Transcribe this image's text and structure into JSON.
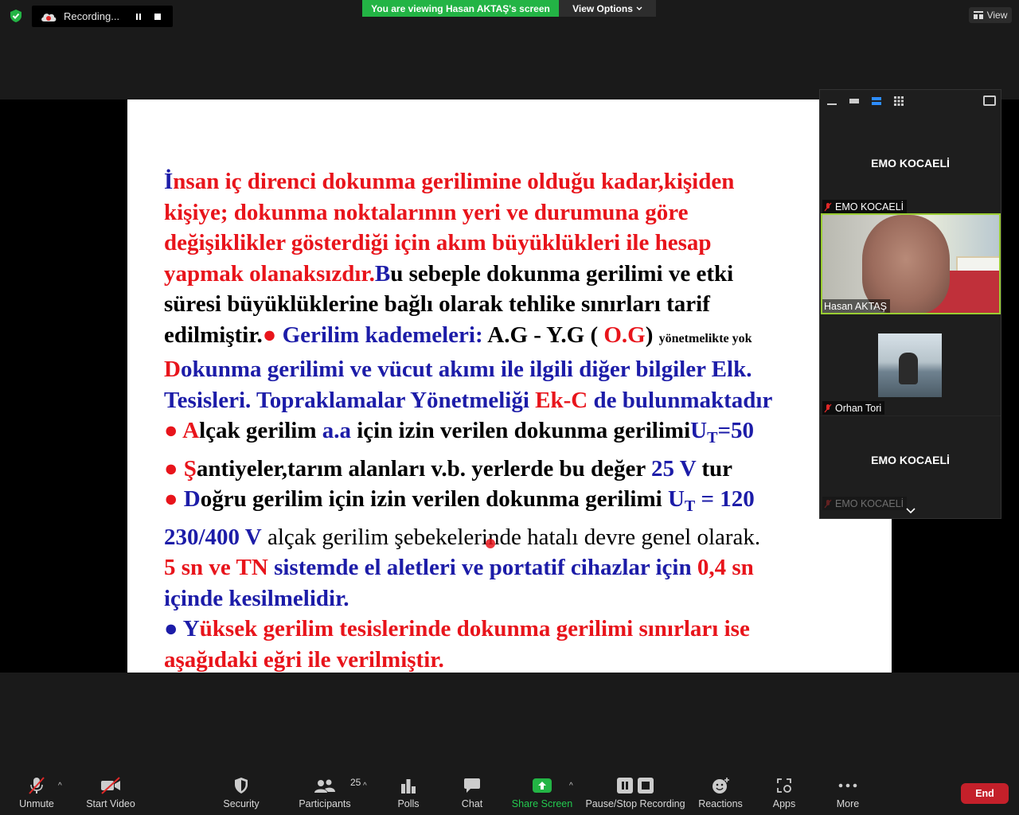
{
  "topbar": {
    "recording_label": "Recording...",
    "viewing_banner": "You are viewing Hasan AKTAŞ's screen",
    "view_options": "View Options",
    "view_label": "View"
  },
  "slide": {
    "lines": [
      [
        [
          "b",
          "İ"
        ],
        [
          "r",
          "nsan iç direnci dokunma gerilimine olduğu kadar,kişiden"
        ]
      ],
      [
        [
          "r",
          "kişiye; dokunma noktalarının yeri ve durumuna göre"
        ]
      ],
      [
        [
          "r",
          "değişiklikler gösterdiği için akım büyüklükleri ile hesap"
        ]
      ],
      [
        [
          "r",
          "yapmak olanaksızdır."
        ],
        [
          "b",
          "B"
        ],
        [
          "k",
          "u sebeple dokunma gerilimi ve etki"
        ]
      ],
      [
        [
          "k",
          "süresi büyüklüklerine bağlı olarak tehlike sınırları tarif"
        ]
      ],
      [
        [
          "k",
          "edilmiştir."
        ],
        [
          "r",
          "● "
        ],
        [
          "b",
          "Gerilim kademeleri: "
        ],
        [
          "k",
          "A.G - Y.G ( "
        ],
        [
          "r",
          "O.G"
        ],
        [
          "k",
          ") "
        ],
        [
          "sm",
          "yönetmelikte yok"
        ]
      ],
      [
        [
          "r",
          "D"
        ],
        [
          "b",
          "okunma gerilimi ve vücut akımı ile ilgili diğer bilgiler Elk."
        ]
      ],
      [
        [
          "b",
          "Tesisleri. Topraklamalar Yönetmeliği "
        ],
        [
          "r",
          "Ek-C"
        ],
        [
          "b",
          " de bulunmaktadır"
        ]
      ],
      [
        [
          "r",
          "● A"
        ],
        [
          "k",
          "lçak gerilim "
        ],
        [
          "b",
          "a.a"
        ],
        [
          "k",
          " için izin verilen dokunma gerilimi"
        ],
        [
          "b",
          "U"
        ],
        [
          "bsub",
          "T"
        ],
        [
          "b",
          "=50"
        ]
      ],
      [
        [
          "r",
          "● Ş"
        ],
        [
          "k",
          "antiyeler,tarım alanları v.b. yerlerde  bu değer "
        ],
        [
          "b",
          "25 V"
        ],
        [
          "k",
          " tur"
        ]
      ],
      [
        [
          "r",
          "● "
        ],
        [
          "b",
          "D"
        ],
        [
          "k",
          "oğru gerilim için izin verilen dokunma gerilimi "
        ],
        [
          "b",
          "U"
        ],
        [
          "bsub",
          "T"
        ],
        [
          "b",
          " = 120"
        ]
      ],
      [
        [
          "b",
          "230/400 V"
        ],
        [
          "n",
          " alçak  gerilim şebekelerinde hatalı devre genel olarak."
        ]
      ],
      [
        [
          "r",
          "5 sn ve TN "
        ],
        [
          "b",
          "sistemde  el aletleri ve portatif cihazlar için  "
        ],
        [
          "r",
          "0,4 sn"
        ]
      ],
      [
        [
          "b",
          "içinde kesilmelidir."
        ]
      ],
      [
        [
          "b",
          "● "
        ],
        [
          "b",
          "Y"
        ],
        [
          "r",
          "üksek gerilim tesislerinde dokunma gerilimi sınırları ise"
        ]
      ],
      [
        [
          "r",
          "aşağıdaki eğri ile verilmiştir."
        ]
      ]
    ]
  },
  "gallery": {
    "tile1_name": "EMO KOCAELİ",
    "tile1_label": "EMO KOCAELİ",
    "tile2_label": "Hasan AKTAŞ",
    "tile3_label": "Orhan Tori",
    "tile4_name": "EMO KOCAELİ",
    "tile4_label": "EMO KOCAELİ"
  },
  "toolbar": {
    "unmute": "Unmute",
    "start_video": "Start Video",
    "security": "Security",
    "participants": "Participants",
    "participants_count": "25",
    "polls": "Polls",
    "chat": "Chat",
    "share_screen": "Share Screen",
    "pause_stop": "Pause/Stop Recording",
    "reactions": "Reactions",
    "apps": "Apps",
    "more": "More",
    "end": "End"
  },
  "colors": {
    "share_green": "#23b445",
    "end_red": "#c4202a",
    "active_speaker": "#9acd32",
    "slide_red": "#e8141b",
    "slide_blue": "#1c1ca8"
  }
}
